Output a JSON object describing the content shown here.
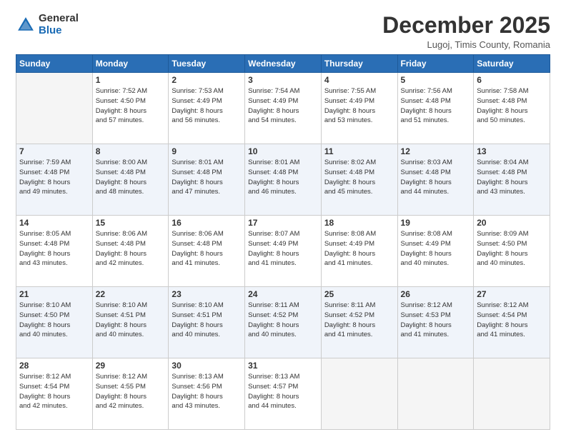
{
  "header": {
    "logo_general": "General",
    "logo_blue": "Blue",
    "month_title": "December 2025",
    "location": "Lugoj, Timis County, Romania"
  },
  "weekdays": [
    "Sunday",
    "Monday",
    "Tuesday",
    "Wednesday",
    "Thursday",
    "Friday",
    "Saturday"
  ],
  "weeks": [
    [
      {
        "day": "",
        "info": ""
      },
      {
        "day": "1",
        "info": "Sunrise: 7:52 AM\nSunset: 4:50 PM\nDaylight: 8 hours\nand 57 minutes."
      },
      {
        "day": "2",
        "info": "Sunrise: 7:53 AM\nSunset: 4:49 PM\nDaylight: 8 hours\nand 56 minutes."
      },
      {
        "day": "3",
        "info": "Sunrise: 7:54 AM\nSunset: 4:49 PM\nDaylight: 8 hours\nand 54 minutes."
      },
      {
        "day": "4",
        "info": "Sunrise: 7:55 AM\nSunset: 4:49 PM\nDaylight: 8 hours\nand 53 minutes."
      },
      {
        "day": "5",
        "info": "Sunrise: 7:56 AM\nSunset: 4:48 PM\nDaylight: 8 hours\nand 51 minutes."
      },
      {
        "day": "6",
        "info": "Sunrise: 7:58 AM\nSunset: 4:48 PM\nDaylight: 8 hours\nand 50 minutes."
      }
    ],
    [
      {
        "day": "7",
        "info": "Sunrise: 7:59 AM\nSunset: 4:48 PM\nDaylight: 8 hours\nand 49 minutes."
      },
      {
        "day": "8",
        "info": "Sunrise: 8:00 AM\nSunset: 4:48 PM\nDaylight: 8 hours\nand 48 minutes."
      },
      {
        "day": "9",
        "info": "Sunrise: 8:01 AM\nSunset: 4:48 PM\nDaylight: 8 hours\nand 47 minutes."
      },
      {
        "day": "10",
        "info": "Sunrise: 8:01 AM\nSunset: 4:48 PM\nDaylight: 8 hours\nand 46 minutes."
      },
      {
        "day": "11",
        "info": "Sunrise: 8:02 AM\nSunset: 4:48 PM\nDaylight: 8 hours\nand 45 minutes."
      },
      {
        "day": "12",
        "info": "Sunrise: 8:03 AM\nSunset: 4:48 PM\nDaylight: 8 hours\nand 44 minutes."
      },
      {
        "day": "13",
        "info": "Sunrise: 8:04 AM\nSunset: 4:48 PM\nDaylight: 8 hours\nand 43 minutes."
      }
    ],
    [
      {
        "day": "14",
        "info": "Sunrise: 8:05 AM\nSunset: 4:48 PM\nDaylight: 8 hours\nand 43 minutes."
      },
      {
        "day": "15",
        "info": "Sunrise: 8:06 AM\nSunset: 4:48 PM\nDaylight: 8 hours\nand 42 minutes."
      },
      {
        "day": "16",
        "info": "Sunrise: 8:06 AM\nSunset: 4:48 PM\nDaylight: 8 hours\nand 41 minutes."
      },
      {
        "day": "17",
        "info": "Sunrise: 8:07 AM\nSunset: 4:49 PM\nDaylight: 8 hours\nand 41 minutes."
      },
      {
        "day": "18",
        "info": "Sunrise: 8:08 AM\nSunset: 4:49 PM\nDaylight: 8 hours\nand 41 minutes."
      },
      {
        "day": "19",
        "info": "Sunrise: 8:08 AM\nSunset: 4:49 PM\nDaylight: 8 hours\nand 40 minutes."
      },
      {
        "day": "20",
        "info": "Sunrise: 8:09 AM\nSunset: 4:50 PM\nDaylight: 8 hours\nand 40 minutes."
      }
    ],
    [
      {
        "day": "21",
        "info": "Sunrise: 8:10 AM\nSunset: 4:50 PM\nDaylight: 8 hours\nand 40 minutes."
      },
      {
        "day": "22",
        "info": "Sunrise: 8:10 AM\nSunset: 4:51 PM\nDaylight: 8 hours\nand 40 minutes."
      },
      {
        "day": "23",
        "info": "Sunrise: 8:10 AM\nSunset: 4:51 PM\nDaylight: 8 hours\nand 40 minutes."
      },
      {
        "day": "24",
        "info": "Sunrise: 8:11 AM\nSunset: 4:52 PM\nDaylight: 8 hours\nand 40 minutes."
      },
      {
        "day": "25",
        "info": "Sunrise: 8:11 AM\nSunset: 4:52 PM\nDaylight: 8 hours\nand 41 minutes."
      },
      {
        "day": "26",
        "info": "Sunrise: 8:12 AM\nSunset: 4:53 PM\nDaylight: 8 hours\nand 41 minutes."
      },
      {
        "day": "27",
        "info": "Sunrise: 8:12 AM\nSunset: 4:54 PM\nDaylight: 8 hours\nand 41 minutes."
      }
    ],
    [
      {
        "day": "28",
        "info": "Sunrise: 8:12 AM\nSunset: 4:54 PM\nDaylight: 8 hours\nand 42 minutes."
      },
      {
        "day": "29",
        "info": "Sunrise: 8:12 AM\nSunset: 4:55 PM\nDaylight: 8 hours\nand 42 minutes."
      },
      {
        "day": "30",
        "info": "Sunrise: 8:13 AM\nSunset: 4:56 PM\nDaylight: 8 hours\nand 43 minutes."
      },
      {
        "day": "31",
        "info": "Sunrise: 8:13 AM\nSunset: 4:57 PM\nDaylight: 8 hours\nand 44 minutes."
      },
      {
        "day": "",
        "info": ""
      },
      {
        "day": "",
        "info": ""
      },
      {
        "day": "",
        "info": ""
      }
    ]
  ]
}
